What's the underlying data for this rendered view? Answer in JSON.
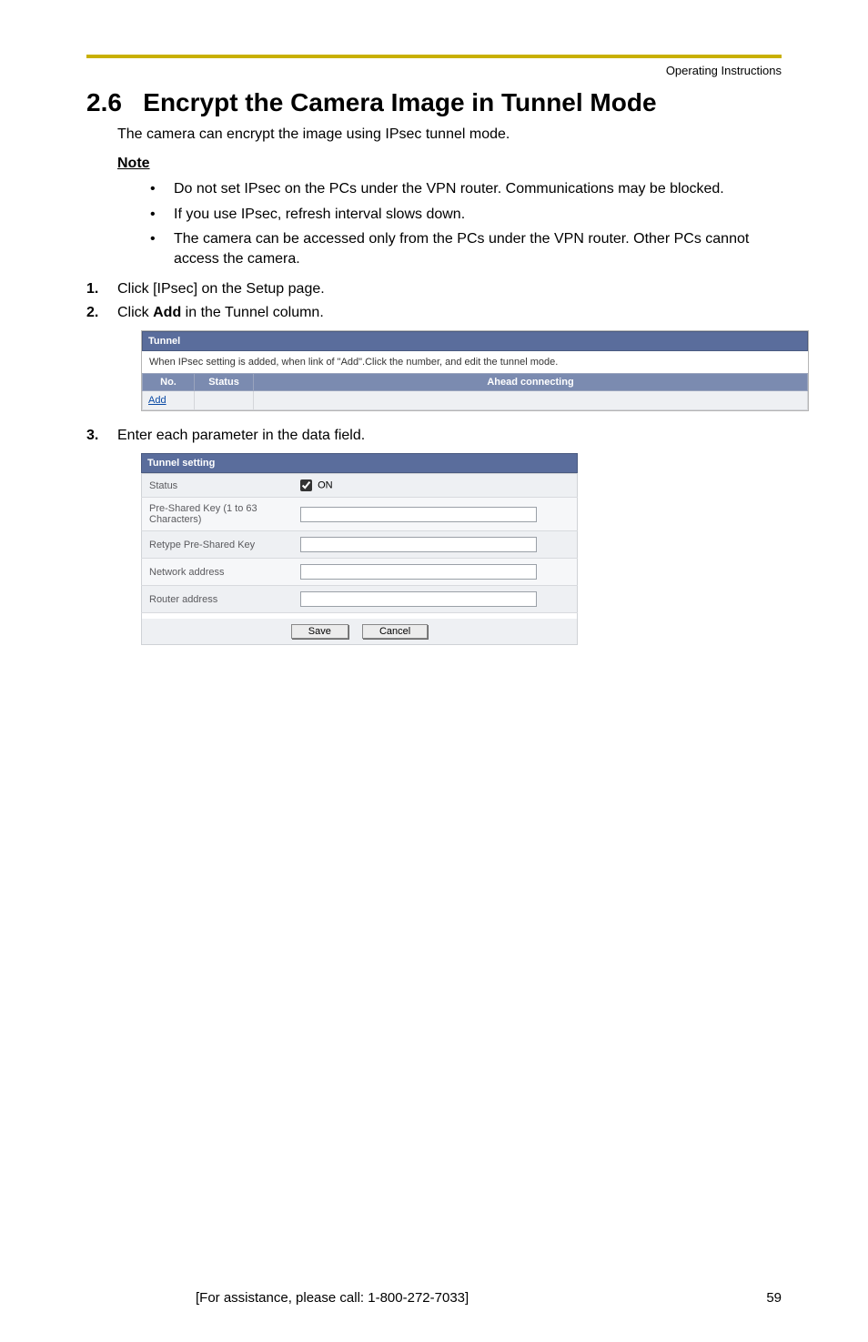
{
  "header": {
    "running_title": "Operating Instructions"
  },
  "section": {
    "number": "2.6",
    "title": "Encrypt the Camera Image in Tunnel Mode",
    "intro": "The camera can encrypt the image using IPsec tunnel mode.",
    "note_heading": "Note",
    "notes": [
      "Do not set IPsec on the PCs under the VPN router. Communications may be blocked.",
      "If you use IPsec, refresh interval slows down.",
      "The camera can be accessed only from the PCs under the VPN router. Other PCs cannot access the camera."
    ],
    "steps": {
      "s1_num": "1.",
      "s1_text_a": "Click [IPsec] on the Setup page.",
      "s2_num": "2.",
      "s2_text_a": "Click ",
      "s2_text_bold": "Add",
      "s2_text_b": " in the Tunnel column.",
      "s3_num": "3.",
      "s3_text_a": "Enter each parameter in the data field."
    }
  },
  "tunnel_table": {
    "title": "Tunnel",
    "caption": "When IPsec setting is added, when link of \"Add\".Click the number, and edit the tunnel mode.",
    "col_no": "No.",
    "col_status": "Status",
    "col_ahead": "Ahead connecting",
    "add_link": "Add"
  },
  "setting_form": {
    "title": "Tunnel setting",
    "row_status_label": "Status",
    "row_status_value": "ON",
    "row_psk_label": "Pre-Shared Key (1 to 63 Characters)",
    "row_retype_label": "Retype Pre-Shared Key",
    "row_network_label": "Network address",
    "row_router_label": "Router address",
    "btn_save": "Save",
    "btn_cancel": "Cancel"
  },
  "footer": {
    "assist": "[For assistance, please call: 1-800-272-7033]",
    "page_num": "59"
  }
}
